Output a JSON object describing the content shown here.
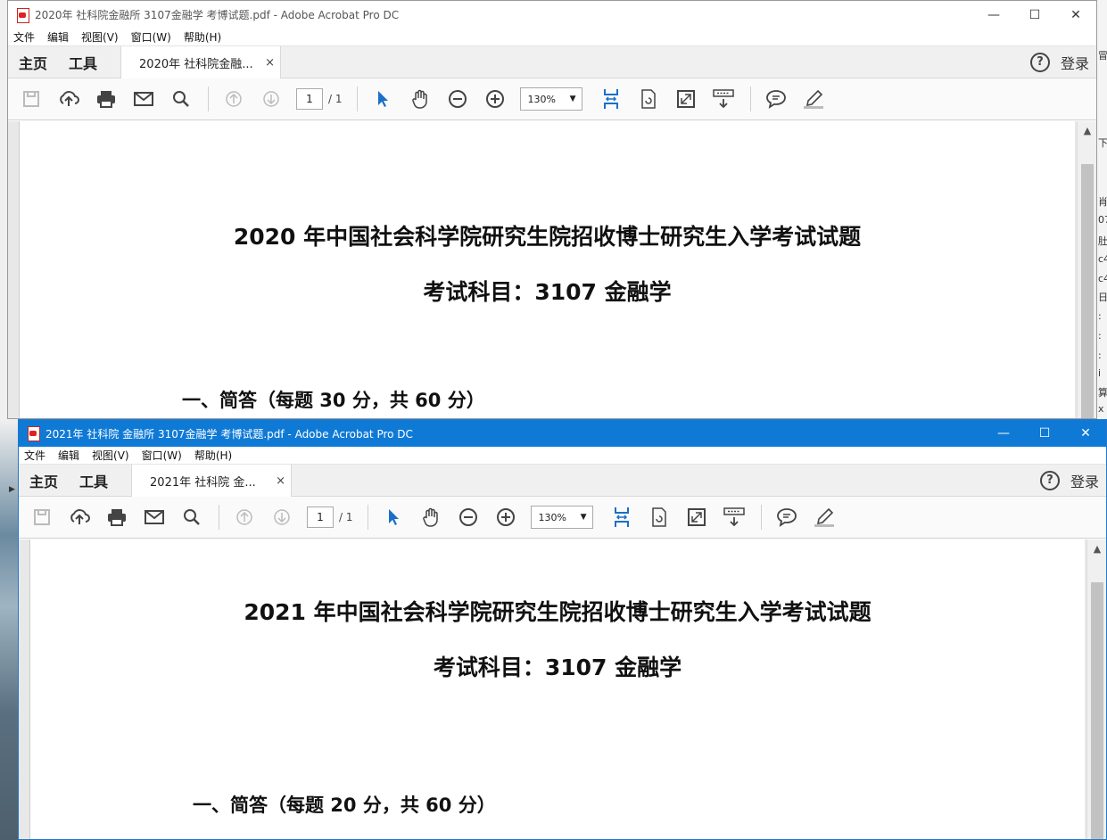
{
  "windows": [
    {
      "title": "2020年 社科院金融所 3107金融学  考博试题.pdf - Adobe Acrobat Pro DC",
      "menu": [
        "文件",
        "编辑",
        "视图(V)",
        "窗口(W)",
        "帮助(H)"
      ],
      "nav": {
        "home": "主页",
        "tools": "工具"
      },
      "tab": {
        "label": "2020年 社科院金融...",
        "close": "×"
      },
      "login": "登录",
      "help": "?",
      "page_number": "1",
      "page_total": "/ 1",
      "zoom": "130%",
      "doc": {
        "title": "2020 年中国社会科学院研究生院招收博士研究生入学考试试题",
        "subject": "考试科目：3107 金融学",
        "section": "一、简答（每题 30 分，共 60 分）"
      }
    },
    {
      "title": "2021年 社科院 金融所 3107金融学  考博试题.pdf - Adobe Acrobat Pro DC",
      "menu": [
        "文件",
        "编辑",
        "视图(V)",
        "窗口(W)",
        "帮助(H)"
      ],
      "nav": {
        "home": "主页",
        "tools": "工具"
      },
      "tab": {
        "label": "2021年 社科院 金...",
        "close": "×"
      },
      "login": "登录",
      "help": "?",
      "page_number": "1",
      "page_total": "/ 1",
      "zoom": "130%",
      "doc": {
        "title": "2021 年中国社会科学院研究生院招收博士研究生入学考试试题",
        "subject": "考试科目：3107 金融学",
        "section": "一、简答（每题 20 分，共 60 分）"
      }
    }
  ],
  "window_controls": {
    "minimize": "—",
    "maximize": "☐",
    "close": "✕"
  },
  "toolbar_icons": [
    "save-icon",
    "upload-icon",
    "print-icon",
    "mail-icon",
    "search-icon",
    "prev-page-icon",
    "next-page-icon",
    "select-cursor-icon",
    "hand-icon",
    "zoom-out-icon",
    "zoom-in-icon",
    "fit-width-icon",
    "rotate-icon",
    "fullscreen-icon",
    "scroll-mode-icon",
    "comment-icon",
    "highlight-icon"
  ],
  "right_edge_fragments": [
    "冒",
    "下",
    "",
    "肖",
    "07",
    "肚",
    "c4",
    "c4",
    "日",
    ":",
    ":",
    ":",
    "i",
    "算",
    "x"
  ]
}
